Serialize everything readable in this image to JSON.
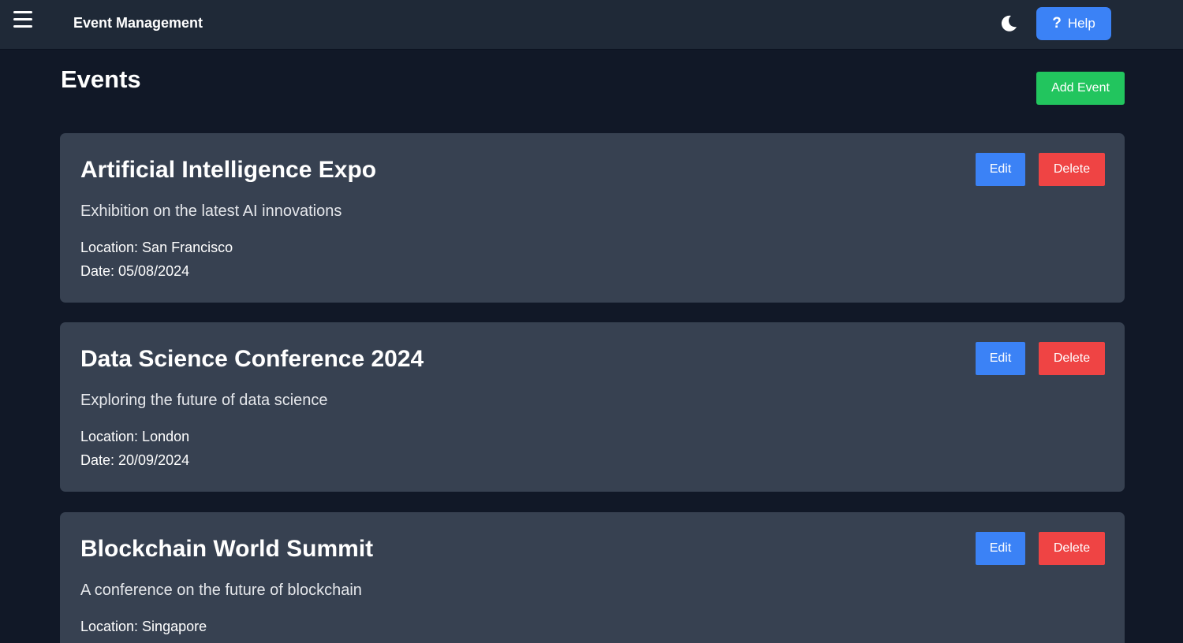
{
  "header": {
    "app_title": "Event Management",
    "menu_icon": "hamburger-menu-icon",
    "theme_icon": "moon-icon",
    "help_icon": "question-mark-icon",
    "help_label": "Help",
    "help_color": "#3b82f6"
  },
  "main": {
    "page_title": "Events",
    "add_event_label": "Add Event",
    "add_event_color": "#22c55e"
  },
  "events": [
    {
      "title": "Artificial Intelligence Expo",
      "description": "Exhibition on the latest AI innovations",
      "location": "Location: San Francisco",
      "date": "Date: 05/08/2024",
      "edit_label": "Edit",
      "delete_label": "Delete"
    },
    {
      "title": "Data Science Conference 2024",
      "description": "Exploring the future of data science",
      "location": "Location: London",
      "date": "Date: 20/09/2024",
      "edit_label": "Edit",
      "delete_label": "Delete"
    },
    {
      "title": "Blockchain World Summit",
      "description": "A conference on the future of blockchain",
      "location": "Location: Singapore",
      "date": "",
      "edit_label": "Edit",
      "delete_label": "Delete"
    }
  ],
  "colors": {
    "background": "#111827",
    "topbar": "#1f2937",
    "card": "#374151",
    "edit": "#3b82f6",
    "delete": "#ef4444"
  }
}
